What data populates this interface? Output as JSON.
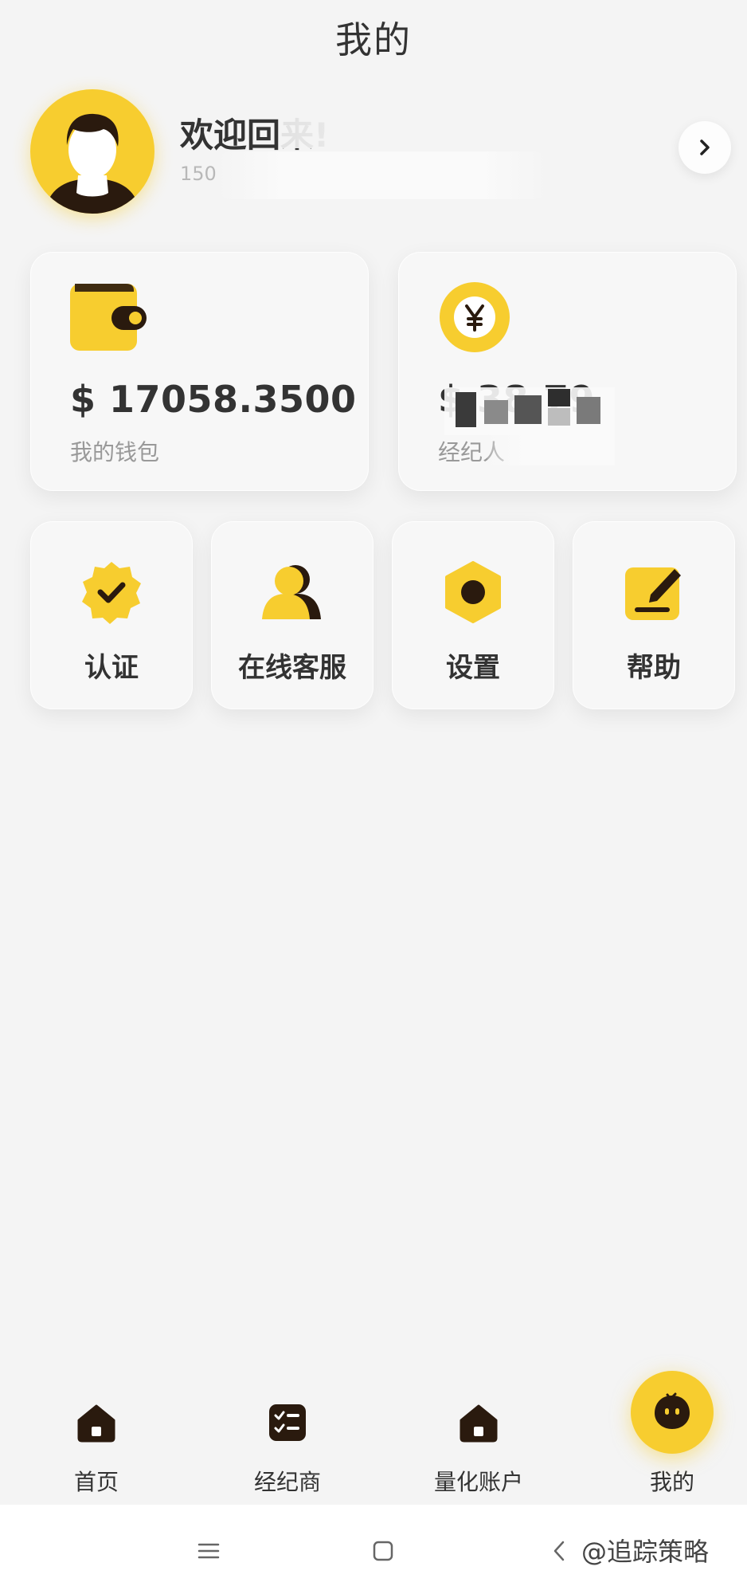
{
  "header": {
    "title": "我的"
  },
  "profile": {
    "welcome": "欢迎回来!",
    "phone_partial": "150"
  },
  "stats": [
    {
      "value": "$ 17058.3500",
      "label": "我的钱包",
      "icon": "wallet-icon"
    },
    {
      "value": "$ 38.79",
      "label": "经纪人",
      "icon": "yen-coin-icon"
    }
  ],
  "functions": [
    {
      "label": "认证",
      "icon": "verified-badge-icon"
    },
    {
      "label": "在线客服",
      "icon": "customer-service-icon"
    },
    {
      "label": "设置",
      "icon": "settings-hexagon-icon"
    },
    {
      "label": "帮助",
      "icon": "help-edit-icon"
    }
  ],
  "tabs": [
    {
      "label": "首页",
      "icon": "home-icon"
    },
    {
      "label": "经纪商",
      "icon": "checklist-icon"
    },
    {
      "label": "量化账户",
      "icon": "home-icon"
    },
    {
      "label": "我的",
      "icon": "mascot-face-icon"
    }
  ],
  "watermark": "@追踪策略",
  "colors": {
    "accent": "#f7cd2f",
    "dark": "#2a1a0e",
    "background": "#f4f4f4"
  }
}
